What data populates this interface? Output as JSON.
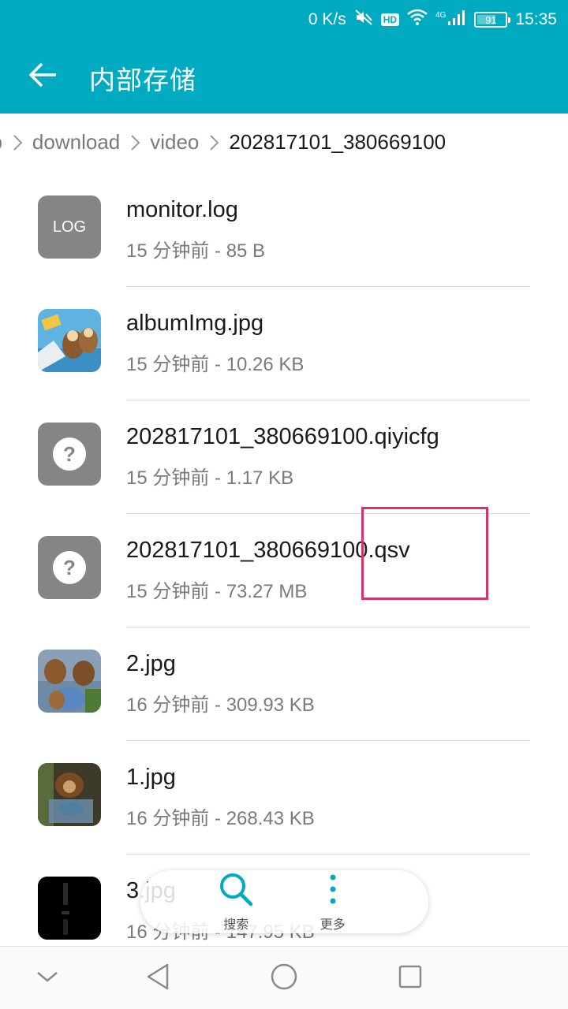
{
  "status_bar": {
    "net_speed": "0 K/s",
    "hd_badge": "HD",
    "network_type": "4G",
    "battery_level": "91",
    "time": "15:35",
    "icons": [
      "mute-icon",
      "wifi-icon",
      "signal-icon",
      "battery-icon"
    ]
  },
  "app_bar": {
    "back_icon": "arrow-left-icon",
    "title": "内部存储"
  },
  "breadcrumb": {
    "items": [
      "pp",
      "download",
      "video",
      "202817101_380669100"
    ],
    "separator_icon": "chevron-right-icon"
  },
  "files": [
    {
      "name": "monitor.log",
      "meta": "15 分钟前 - 85 B",
      "thumb_type": "log",
      "thumb_label": "LOG"
    },
    {
      "name": "albumImg.jpg",
      "meta": "15 分钟前 - 10.26 KB",
      "thumb_type": "image"
    },
    {
      "name": "202817101_380669100.qiyicfg",
      "meta": "15 分钟前 - 1.17 KB",
      "thumb_type": "unknown",
      "thumb_label": "?"
    },
    {
      "name": "202817101_380669100.qsv",
      "meta": "15 分钟前 - 73.27 MB",
      "thumb_type": "unknown",
      "thumb_label": "?"
    },
    {
      "name": "2.jpg",
      "meta": "16 分钟前 - 309.93 KB",
      "thumb_type": "image"
    },
    {
      "name": "1.jpg",
      "meta": "16 分钟前 - 268.43 KB",
      "thumb_type": "image"
    },
    {
      "name": "3.jpg",
      "meta": "16 分钟前 - 147.95 KB",
      "thumb_type": "image"
    }
  ],
  "floating_toolbar": {
    "search_label": "搜索",
    "more_label": "更多"
  },
  "nav_bar": {
    "buttons": [
      "collapse-icon",
      "back-triangle-icon",
      "home-circle-icon",
      "recents-square-icon"
    ]
  },
  "colors": {
    "accent": "#00abc2",
    "highlight": "#d6336c",
    "thumb_gray": "#858585"
  }
}
